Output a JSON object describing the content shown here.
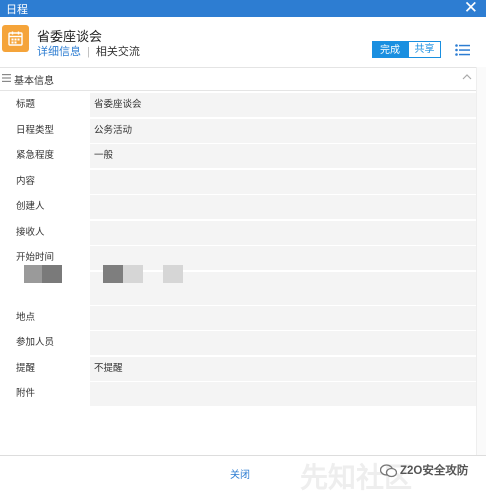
{
  "window": {
    "title": "日程",
    "close_glyph": "✕"
  },
  "header": {
    "title": "省委座谈会",
    "tabs": [
      "详细信息",
      "相关交流"
    ],
    "buttons": {
      "done": "完成",
      "share": "共享"
    },
    "accent": "#2d7dd2",
    "icon_color": "#f5a43a"
  },
  "section": {
    "label": "基本信息"
  },
  "fields": [
    {
      "label": "标题",
      "value": "省委座谈会"
    },
    {
      "label": "日程类型",
      "value": "公务活动"
    },
    {
      "label": "紧急程度",
      "value": "一般"
    },
    {
      "label": "内容",
      "value": ""
    },
    {
      "label": "创建人",
      "value": ""
    },
    {
      "label": "接收人",
      "value": ""
    },
    {
      "label": "开始时间",
      "value": ""
    },
    {
      "label": "",
      "value": ""
    },
    {
      "label": "地点",
      "value": ""
    },
    {
      "label": "参加人员",
      "value": ""
    },
    {
      "label": "提醒",
      "value": "不提醒"
    },
    {
      "label": "附件",
      "value": ""
    }
  ],
  "footer": {
    "close": "关闭"
  },
  "watermark": {
    "text": "Z2O安全攻防",
    "faint": "先知社区"
  }
}
